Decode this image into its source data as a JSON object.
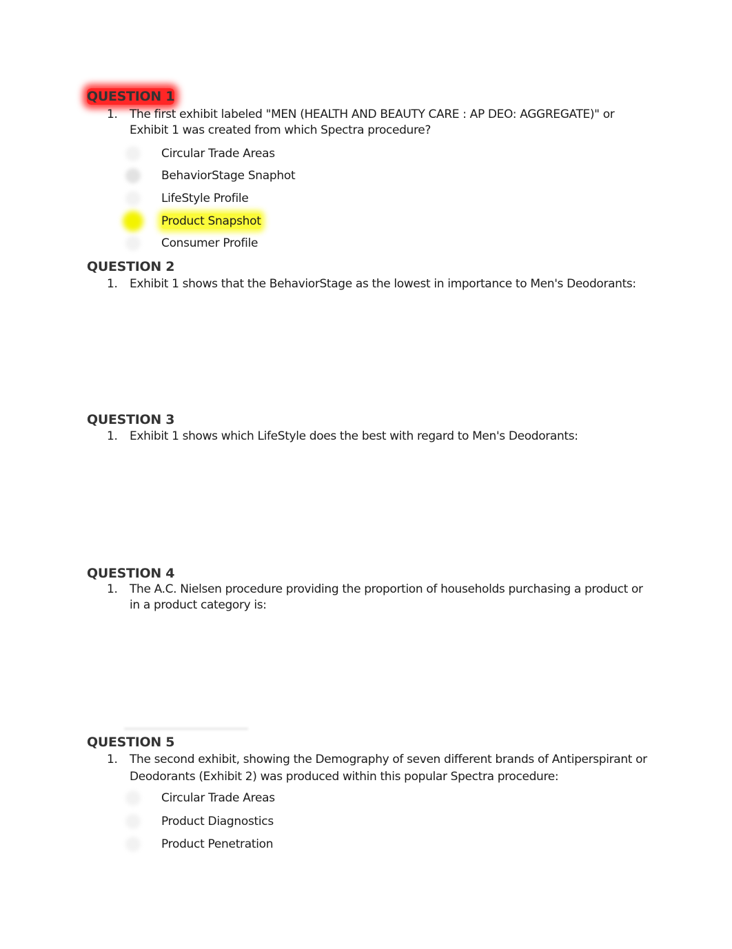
{
  "questions": [
    {
      "heading": "QUESTION 1",
      "number": "1.",
      "text": "The first exhibit labeled \"MEN (HEALTH AND BEAUTY CARE : AP DEO: AGGREGATE)\" or Exhibit 1 was created from which Spectra procedure?",
      "options": [
        {
          "label": "Circular Trade Areas",
          "selected": false
        },
        {
          "label": "BehaviorStage Snaphot",
          "selected": false
        },
        {
          "label": "LifeStyle Profile",
          "selected": false
        },
        {
          "label": "Product Snapshot",
          "selected": true
        },
        {
          "label": "Consumer Profile",
          "selected": false
        }
      ]
    },
    {
      "heading": "QUESTION 2",
      "number": "1.",
      "text": "Exhibit 1 shows that the BehaviorStage as the lowest in importance to Men's Deodorants:",
      "options": []
    },
    {
      "heading": "QUESTION 3",
      "number": "1.",
      "text": "Exhibit 1 shows which LifeStyle does the best with regard to Men's Deodorants:",
      "options": []
    },
    {
      "heading": "QUESTION 4",
      "number": "1.",
      "text": "The A.C. Nielsen procedure providing the proportion of households purchasing a product or in a product category is:",
      "options": []
    },
    {
      "heading": "QUESTION 5",
      "number": "1.",
      "text": "The second exhibit, showing the Demography of seven different brands of Antiperspirant or Deodorants (Exhibit 2) was produced within this popular Spectra procedure:",
      "options": [
        {
          "label": "Circular Trade Areas",
          "selected": false
        },
        {
          "label": "Product Diagnostics",
          "selected": false
        },
        {
          "label": "Product Penetration",
          "selected": false
        }
      ]
    }
  ],
  "highlight_colors": {
    "question_heading": "#ff0000",
    "selected_answer": "#ffff00"
  }
}
